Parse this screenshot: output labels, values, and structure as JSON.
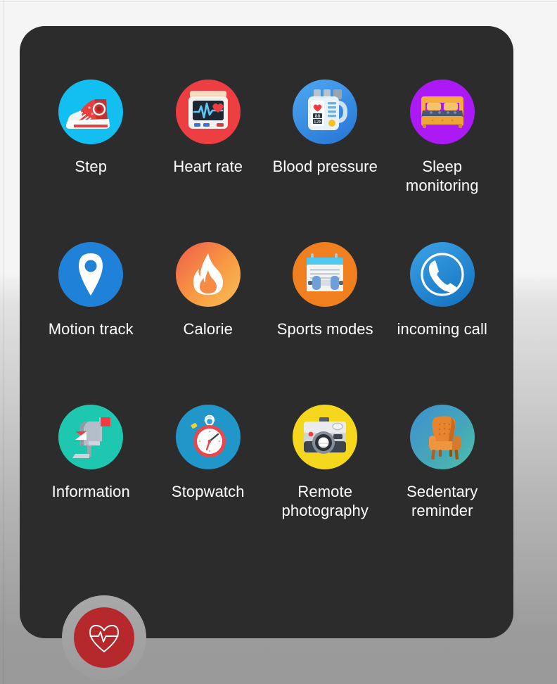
{
  "app": {
    "panel_background": "#2c2c2c",
    "page_background_top": "#f5f5f6",
    "page_background_bottom": "#9a9a9a"
  },
  "grid": {
    "columns": 4,
    "items": [
      {
        "id": "step",
        "label": "Step",
        "icon": "sneaker-icon",
        "circle_color": "#12bff0"
      },
      {
        "id": "heart-rate",
        "label": "Heart rate",
        "icon": "ecg-monitor-icon",
        "circle_color": "#ed3e42"
      },
      {
        "id": "blood-pressure",
        "label": "Blood pressure",
        "icon": "blood-pressure-icon",
        "circle_color": "#2f8fe8",
        "readout_systolic": "88",
        "readout_diastolic": "120"
      },
      {
        "id": "sleep-monitoring",
        "label": "Sleep monitoring",
        "icon": "bed-icon",
        "circle_color": "#ab1af5"
      },
      {
        "id": "motion-track",
        "label": "Motion track",
        "icon": "map-pin-icon",
        "circle_color": "#1f82d8"
      },
      {
        "id": "calorie",
        "label": "Calorie",
        "icon": "flame-icon",
        "circle_color": "#f59a3c"
      },
      {
        "id": "sports-modes",
        "label": "Sports modes",
        "icon": "workout-log-icon",
        "circle_color": "#f07f20"
      },
      {
        "id": "incoming-call",
        "label": "incoming call",
        "icon": "phone-handset-icon",
        "circle_color": "#1c87d6"
      },
      {
        "id": "information",
        "label": "Information",
        "icon": "mailbox-icon",
        "circle_color": "#1ec8b0"
      },
      {
        "id": "stopwatch",
        "label": "Stopwatch",
        "icon": "stopwatch-icon",
        "circle_color": "#2196c9"
      },
      {
        "id": "remote-photography",
        "label": "Remote photography",
        "icon": "camera-icon",
        "circle_color": "#f5d81e"
      },
      {
        "id": "sedentary-reminder",
        "label": "Sedentary reminder",
        "icon": "armchair-icon",
        "circle_color": "#4f9fb5"
      }
    ]
  },
  "fab": {
    "icon": "heartbeat-icon",
    "color": "#b5282c"
  }
}
